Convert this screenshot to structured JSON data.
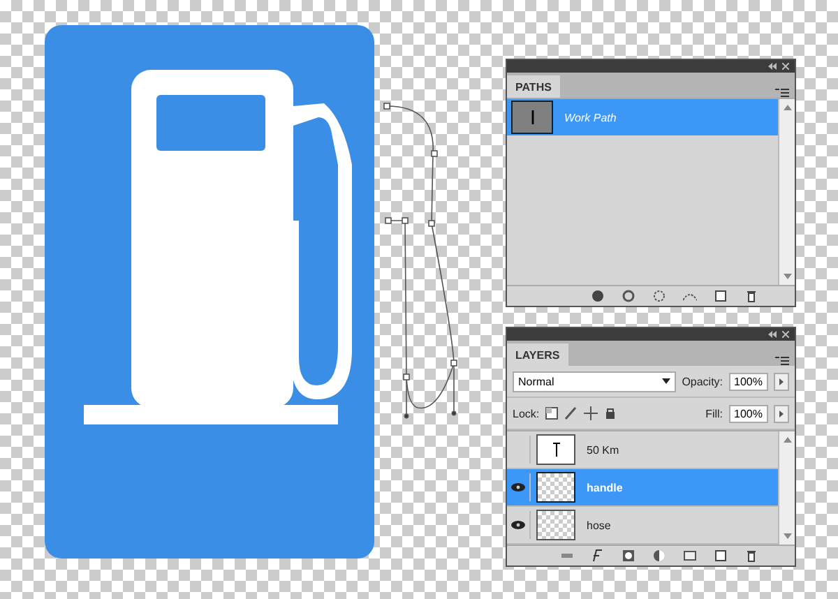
{
  "paths_panel": {
    "tab": "PATHS",
    "paths": [
      {
        "name": "Work Path",
        "selected": true
      }
    ]
  },
  "layers_panel": {
    "tab": "LAYERS",
    "blend_mode": "Normal",
    "opacity_label": "Opacity:",
    "opacity": "100%",
    "lock_label": "Lock:",
    "fill_label": "Fill:",
    "fill": "100%",
    "layers": [
      {
        "name": "50 Km",
        "kind": "text",
        "visible": false,
        "selected": false
      },
      {
        "name": "handle",
        "kind": "pixel",
        "visible": true,
        "selected": true
      },
      {
        "name": "hose",
        "kind": "pixel",
        "visible": true,
        "selected": false
      }
    ]
  }
}
